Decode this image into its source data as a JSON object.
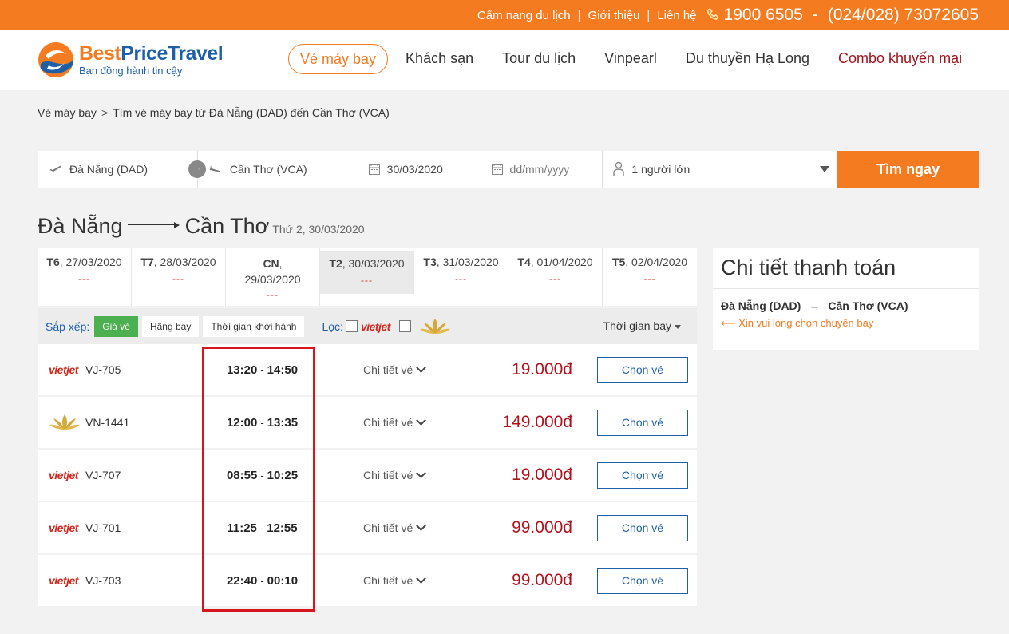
{
  "topbar": {
    "links": [
      "Cẩm nang du lịch",
      "Giới thiệu",
      "Liên hệ"
    ],
    "separator": "|",
    "phone1": "1900 6505",
    "dash": "-",
    "phone2": "(024/028) 73072605"
  },
  "logo": {
    "name_best": "Best",
    "name_price": "Price",
    "name_travel": "Travel",
    "tagline": "Bạn đồng hành tin cậy"
  },
  "nav": {
    "flights": "Vé máy bay",
    "hotels": "Khách sạn",
    "tours": "Tour du lịch",
    "vinpearl": "Vinpearl",
    "cruise": "Du thuyền Hạ Long",
    "combo": "Combo khuyến mại"
  },
  "breadcrumb": {
    "root": "Vé máy bay",
    "arrow": ">",
    "current": "Tìm vé máy bay từ Đà Nẵng (DAD) đến Cần Thơ (VCA)"
  },
  "search": {
    "from": "Đà Nẵng (DAD)",
    "to": "Cần Thơ (VCA)",
    "depart_date": "30/03/2020",
    "return_placeholder": "dd/mm/yyyy",
    "passengers": "1 người lớn",
    "button": "Tìm ngay"
  },
  "route": {
    "from": "Đà Nẵng",
    "to": "Cần Thơ",
    "date": "Thứ 2, 30/03/2020"
  },
  "date_tabs": [
    {
      "day": "T6",
      "date": ", 27/03/2020",
      "price": "---"
    },
    {
      "day": "T7",
      "date": ", 28/03/2020",
      "price": "---"
    },
    {
      "day": "CN",
      "date": "29/03/2020",
      "price": "---"
    },
    {
      "day": "T2",
      "date": ", 30/03/2020",
      "price": "---"
    },
    {
      "day": "T3",
      "date": ", 31/03/2020",
      "price": "---"
    },
    {
      "day": "T4",
      "date": ", 01/04/2020",
      "price": "---"
    },
    {
      "day": "T5",
      "date": ", 02/04/2020",
      "price": "---"
    }
  ],
  "filter": {
    "sort_label": "Sắp xếp:",
    "sort_price": "Giá vé",
    "sort_airline": "Hãng bay",
    "sort_depart": "Thời gian khởi hành",
    "filter_label": "Lọc:",
    "vietjet_logo": "vietjet",
    "duration": "Thời gian bay"
  },
  "flights": [
    {
      "airline_logo": "vietjet",
      "code": "VJ-705",
      "depart": "13:20",
      "arrive": "14:50",
      "detail": "Chi tiết vé",
      "price": "19.000đ",
      "button": "Chọn vé"
    },
    {
      "airline_logo": "",
      "code": "VN-1441",
      "depart": "12:00",
      "arrive": "13:35",
      "detail": "Chi tiết vé",
      "price": "149.000đ",
      "button": "Chọn vé"
    },
    {
      "airline_logo": "vietjet",
      "code": "VJ-707",
      "depart": "08:55",
      "arrive": "10:25",
      "detail": "Chi tiết vé",
      "price": "19.000đ",
      "button": "Chọn vé"
    },
    {
      "airline_logo": "vietjet",
      "code": "VJ-701",
      "depart": "11:25",
      "arrive": "12:55",
      "detail": "Chi tiết vé",
      "price": "99.000đ",
      "button": "Chọn vé"
    },
    {
      "airline_logo": "vietjet",
      "code": "VJ-703",
      "depart": "22:40",
      "arrive": "00:10",
      "detail": "Chi tiết vé",
      "price": "99.000đ",
      "button": "Chọn vé"
    }
  ],
  "time_separator": "-",
  "payment": {
    "title": "Chi tiết thanh toán",
    "from": "Đà Nẵng (DAD)",
    "arrow": "→",
    "to": "Cần Thơ (VCA)",
    "message": "⟵ Xin vui lòng chọn chuyến bay"
  },
  "colors": {
    "brand_orange": "#f47b20",
    "brand_blue": "#1f5fa8",
    "price_red": "#b3121d",
    "highlight_red": "#d8141e"
  }
}
